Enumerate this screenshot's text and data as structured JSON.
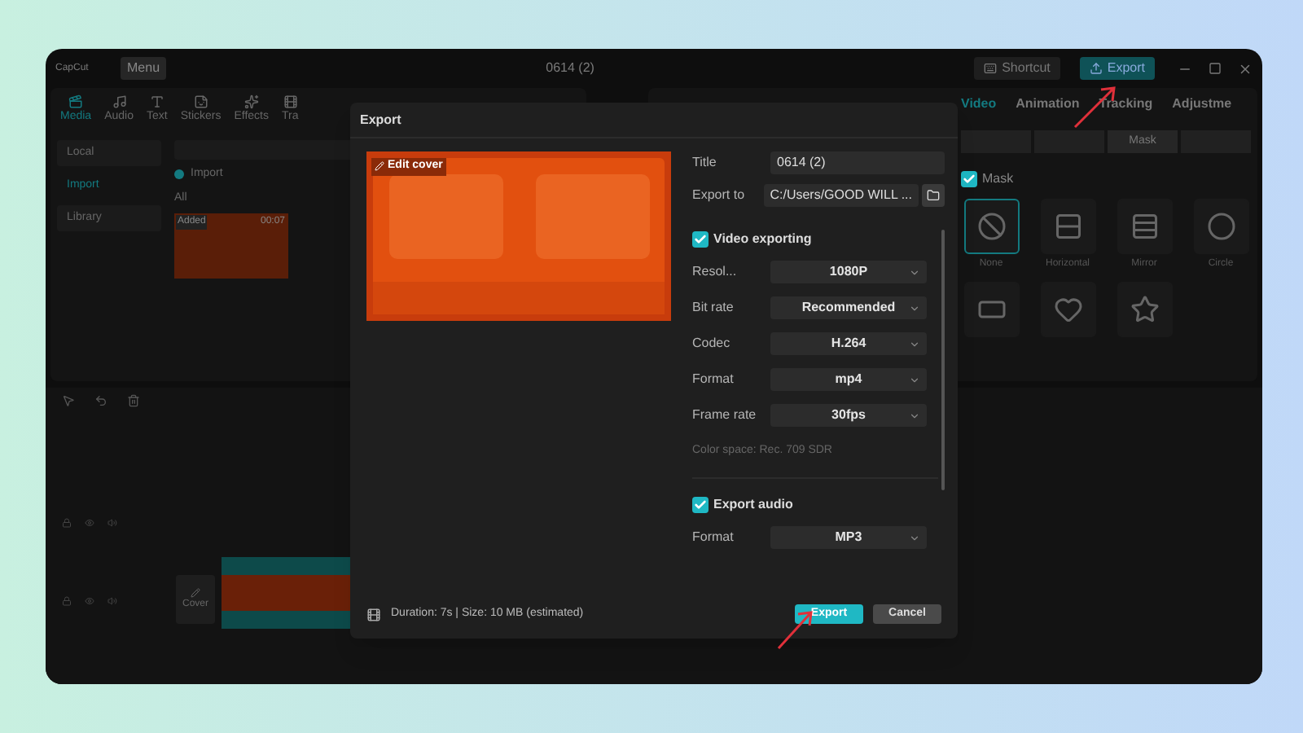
{
  "app": {
    "logo": "CapCut",
    "menu": "Menu",
    "project_title": "0614 (2)",
    "shortcut": "Shortcut",
    "export": "Export"
  },
  "tool_tabs": [
    {
      "label": "Media",
      "selected": true
    },
    {
      "label": "Audio",
      "selected": false
    },
    {
      "label": "Text",
      "selected": false
    },
    {
      "label": "Stickers",
      "selected": false
    },
    {
      "label": "Effects",
      "selected": false
    },
    {
      "label": "Tra",
      "selected": false
    }
  ],
  "media_sidebar": [
    {
      "label": "Local",
      "selected": false
    },
    {
      "label": "Import",
      "selected": true
    },
    {
      "label": "Library",
      "selected": false
    }
  ],
  "media": {
    "import": "Import",
    "filter": "All",
    "clip": {
      "badge": "Added",
      "duration": "00:07"
    }
  },
  "inspector_tabs": [
    {
      "label": "Video",
      "selected": true
    },
    {
      "label": "Animation",
      "selected": false
    },
    {
      "label": "Tracking",
      "selected": false
    },
    {
      "label": "Adjustme",
      "selected": false
    }
  ],
  "inspector_segment": {
    "label": "Mask"
  },
  "mask": {
    "label": "Mask",
    "checked": true,
    "options": [
      {
        "label": "None",
        "selected": true
      },
      {
        "label": "Horizontal",
        "selected": false
      },
      {
        "label": "Mirror",
        "selected": false
      },
      {
        "label": "Circle",
        "selected": false
      },
      {
        "selected": false
      },
      {
        "selected": false
      },
      {
        "selected": false
      }
    ]
  },
  "timeline": {
    "cover": "Cover"
  },
  "dialog": {
    "title": "Export",
    "edit_cover": "Edit cover",
    "fields": [
      {
        "label": "Title",
        "value": "0614 (2)"
      },
      {
        "label": "Export to",
        "value": "C:/Users/GOOD WILL ..."
      }
    ],
    "video": {
      "label": "Video exporting",
      "checked": true,
      "settings": [
        {
          "label": "Resol...",
          "value": "1080P"
        },
        {
          "label": "Bit rate",
          "value": "Recommended"
        },
        {
          "label": "Codec",
          "value": "H.264"
        },
        {
          "label": "Format",
          "value": "mp4"
        },
        {
          "label": "Frame rate",
          "value": "30fps"
        }
      ],
      "color_space": "Color space: Rec. 709 SDR"
    },
    "audio": {
      "label": "Export audio",
      "checked": true,
      "settings": [
        {
          "label": "Format",
          "value": "MP3"
        }
      ]
    },
    "summary": "Duration: 7s | Size: 10 MB (estimated)",
    "buttons": [
      {
        "label": "Export",
        "kind": "primary"
      },
      {
        "label": "Cancel",
        "kind": "secondary"
      }
    ]
  }
}
